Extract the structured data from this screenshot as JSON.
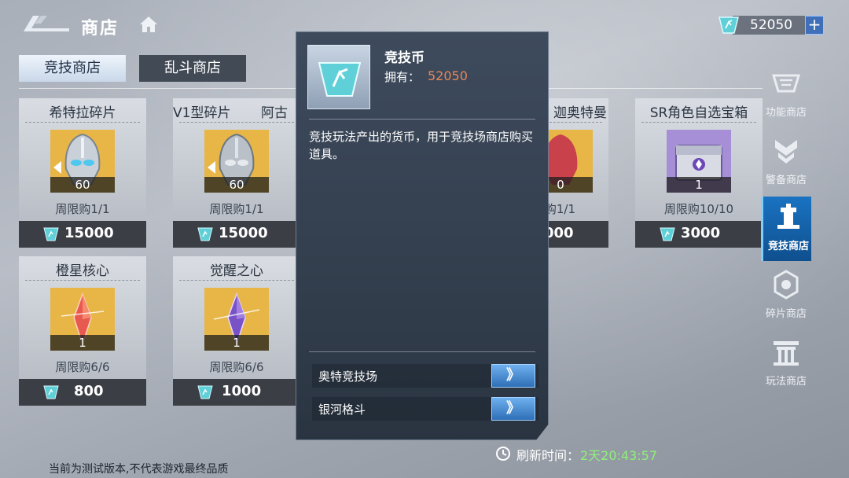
{
  "header": {
    "title": "商店",
    "currency": {
      "icon": "arena-coin-icon",
      "value": "52050",
      "add_label": "+"
    }
  },
  "tabs": [
    {
      "label": "竞技商店",
      "active": true
    },
    {
      "label": "乱斗商店",
      "active": false
    }
  ],
  "items": [
    {
      "name": "希特拉碎片",
      "qty": "60",
      "limit": "周限购1/1",
      "price": "15000",
      "icon": "silver-hero-mask-icon"
    },
    {
      "name": "V1型碎片",
      "qty": "60",
      "limit": "周限购1/1",
      "price": "15000",
      "icon": "silver-hero-mask-icon"
    },
    {
      "name": "SR角色自选宝箱",
      "qty": "1",
      "limit": "周限购10/10",
      "price": "3000",
      "icon": "purple-chest-icon"
    },
    {
      "name": "橙星核心",
      "qty": "1",
      "limit": "周限购6/6",
      "price": "800",
      "icon": "orange-crystal-icon"
    },
    {
      "name": "觉醒之心",
      "qty": "1",
      "limit": "周限购6/6",
      "price": "1000",
      "icon": "purple-crystal-icon"
    }
  ],
  "partial_items": {
    "name_a": "阿古",
    "name_b": "迦奥特曼",
    "qty": "0",
    "limit": "购1/1",
    "price": "000"
  },
  "side_nav": [
    {
      "label": "功能商店",
      "icon": "function-shop-icon",
      "active": false
    },
    {
      "label": "警备商店",
      "icon": "guard-shop-icon",
      "active": false
    },
    {
      "label": "竞技商店",
      "icon": "arena-shop-icon",
      "active": true
    },
    {
      "label": "碎片商店",
      "icon": "fragment-shop-icon",
      "active": false
    },
    {
      "label": "玩法商店",
      "icon": "gameplay-shop-icon",
      "active": false
    }
  ],
  "popup": {
    "name": "竞技币",
    "own_label": "拥有：",
    "own_value": "52050",
    "description": "竞技玩法产出的货币，用于竞技场商店购买道具。",
    "sources": [
      {
        "label": "奥特竞技场",
        "go": "》"
      },
      {
        "label": "银河格斗",
        "go": "》"
      }
    ]
  },
  "refresh": {
    "label": "刷新时间：",
    "value": "2天20:43:57"
  },
  "footer_note": "当前为测试版本,不代表游戏最终品质",
  "colors": {
    "accent_blue": "#1a73c2",
    "own_value": "#e8865a",
    "timer_green": "#8ef07a"
  }
}
